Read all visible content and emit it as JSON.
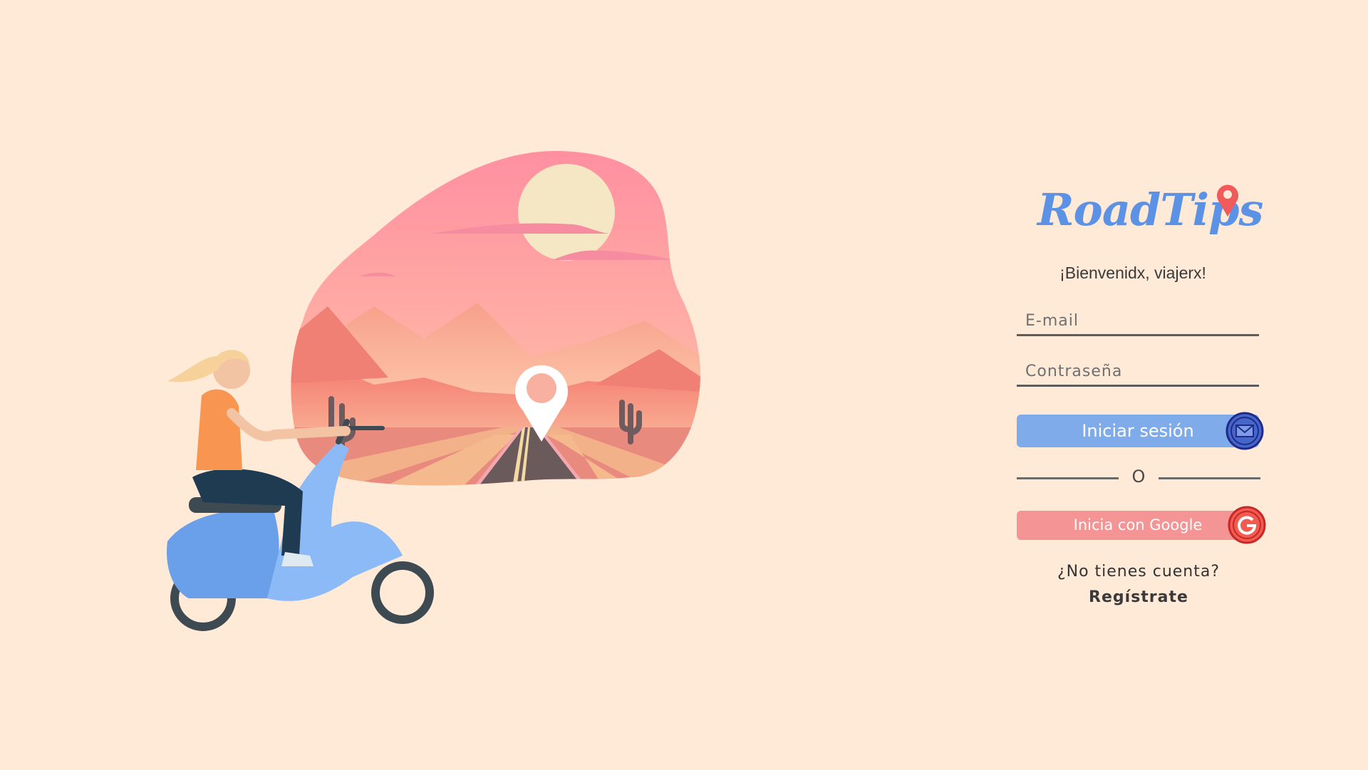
{
  "brand": {
    "name": "RoadTips",
    "color": "#5b92e5",
    "pin_color": "#f05a5a"
  },
  "login": {
    "welcome": "¡Bienvenidx, viajerx!",
    "email_placeholder": "E-mail",
    "password_placeholder": "Contraseña",
    "login_button": "Iniciar sesión",
    "divider_text": "O",
    "google_button": "Inicia con Google",
    "no_account": "¿No tienes cuenta?",
    "register_link": "Regístrate"
  },
  "colors": {
    "background": "#ffe9d7",
    "login_button": "#7fabea",
    "google_button": "#f59494",
    "scooter": "#7fb0f5"
  },
  "icons": {
    "login_button_icon": "envelope-icon",
    "google_button_icon": "google-g-icon",
    "brand_icon": "location-pin-icon"
  }
}
